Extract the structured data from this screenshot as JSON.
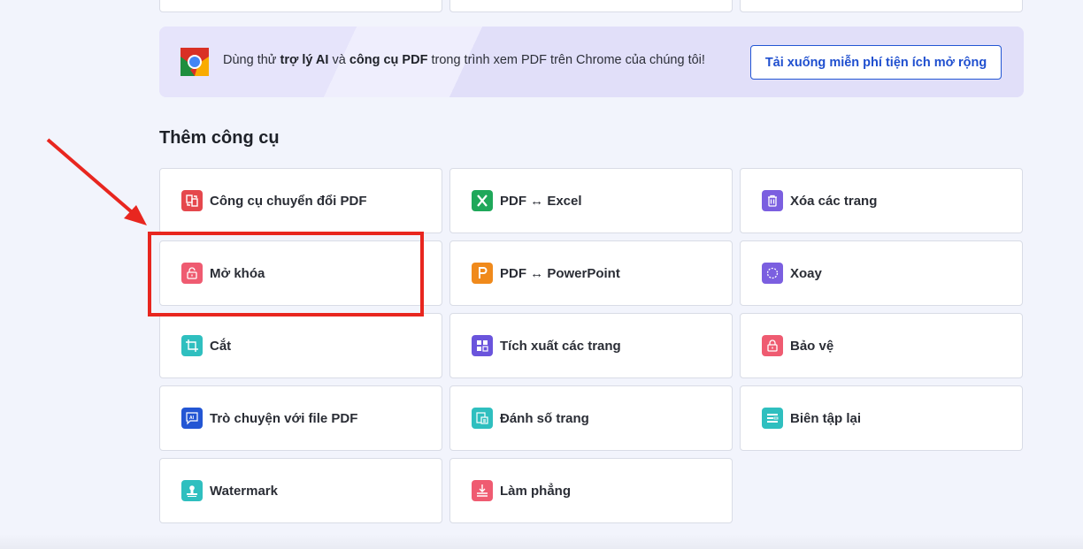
{
  "banner": {
    "text_prefix": "Dùng thử ",
    "text_bold_1": "trợ lý AI",
    "text_mid": " và ",
    "text_bold_2": "công cụ PDF",
    "text_suffix": " trong trình xem PDF trên Chrome của chúng tôi!",
    "button_label": "Tải xuống miễn phí tiện ích mở rộng",
    "logo_icon": "chrome-logo-icon"
  },
  "section": {
    "title": "Thêm công cụ"
  },
  "tools": [
    {
      "label": "Công cụ chuyển đổi PDF",
      "icon": "convert-icon",
      "color": "#e5484d"
    },
    {
      "label": "PDF ↔ Excel",
      "icon": "excel-icon",
      "color": "#1fa85a"
    },
    {
      "label": "Xóa các trang",
      "icon": "trash-icon",
      "color": "#7b5fe0"
    },
    {
      "label": "Mở khóa",
      "icon": "unlock-icon",
      "color": "#ef5b71"
    },
    {
      "label": "PDF ↔ PowerPoint",
      "icon": "powerpoint-icon",
      "color": "#f08a1c"
    },
    {
      "label": "Xoay",
      "icon": "rotate-icon",
      "color": "#7b5fe0"
    },
    {
      "label": "Cắt",
      "icon": "crop-icon",
      "color": "#2fbfbf"
    },
    {
      "label": "Tích xuất các trang",
      "icon": "extract-pages-icon",
      "color": "#6a54dc"
    },
    {
      "label": "Bảo vệ",
      "icon": "lock-icon",
      "color": "#ef5b71"
    },
    {
      "label": "Trò chuyện với file PDF",
      "icon": "ai-chat-icon",
      "color": "#2356d4"
    },
    {
      "label": "Đánh số trang",
      "icon": "page-number-icon",
      "color": "#2fbfbf"
    },
    {
      "label": "Biên tập lại",
      "icon": "redact-icon",
      "color": "#2fbfbf"
    },
    {
      "label": "Watermark",
      "icon": "watermark-icon",
      "color": "#2fbfbf"
    },
    {
      "label": "Làm phẳng",
      "icon": "flatten-icon",
      "color": "#ef5b71"
    }
  ],
  "annotation": {
    "highlight_color": "#e8261f"
  }
}
